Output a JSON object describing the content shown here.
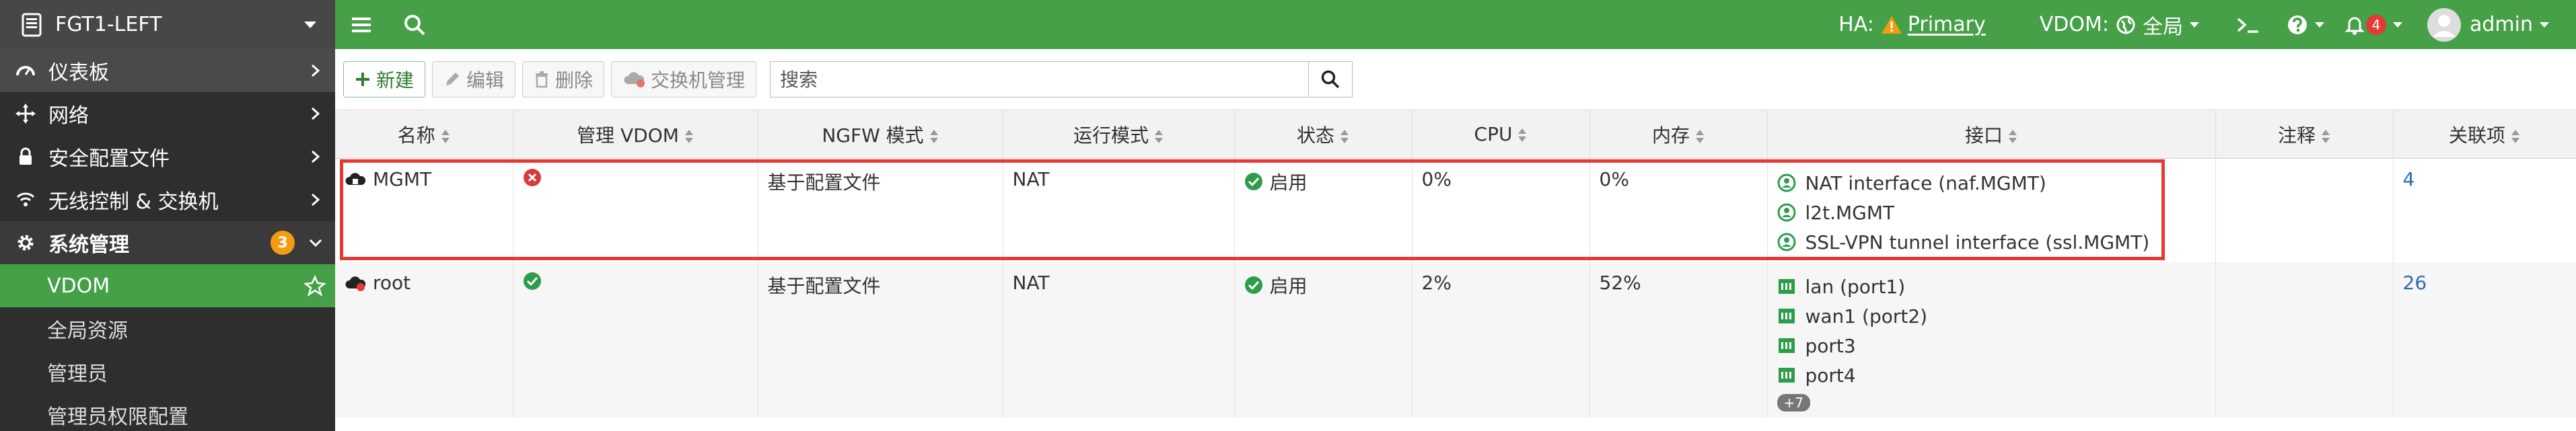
{
  "sidebar": {
    "device_name": "FGT1-LEFT",
    "items": [
      {
        "label": "仪表板",
        "icon": "dashboard-icon"
      },
      {
        "label": "网络",
        "icon": "network-icon"
      },
      {
        "label": "安全配置文件",
        "icon": "lock-icon"
      },
      {
        "label": "无线控制 & 交换机",
        "icon": "wifi-icon"
      }
    ],
    "section": {
      "label": "系统管理",
      "icon": "gear-icon",
      "badge": "3"
    },
    "sub_items": [
      {
        "label": "VDOM",
        "active": true
      },
      {
        "label": "全局资源"
      },
      {
        "label": "管理员"
      },
      {
        "label": "管理员权限配置"
      }
    ]
  },
  "topbar": {
    "ha_label": "HA:",
    "ha_value": "Primary",
    "vdom_label": "VDOM:",
    "vdom_value": "全局",
    "notification_count": "4",
    "user": "admin"
  },
  "toolbar": {
    "new_label": "新建",
    "edit_label": "编辑",
    "delete_label": "删除",
    "switch_label": "交换机管理",
    "search_placeholder": "搜索"
  },
  "table": {
    "columns": [
      "名称",
      "管理 VDOM",
      "NGFW 模式",
      "运行模式",
      "状态",
      "CPU",
      "内存",
      "接口",
      "注释",
      "关联项"
    ],
    "rows": [
      {
        "name": "MGMT",
        "mgmt_vdom": "no",
        "ngfw_mode": "基于配置文件",
        "op_mode": "NAT",
        "status": "启用",
        "cpu": "0%",
        "memory": "0%",
        "interfaces": [
          "NAT interface (naf.MGMT)",
          "l2t.MGMT",
          "SSL-VPN tunnel interface (ssl.MGMT)"
        ],
        "comment": "",
        "refs": "4"
      },
      {
        "name": "root",
        "mgmt_vdom": "yes",
        "ngfw_mode": "基于配置文件",
        "op_mode": "NAT",
        "status": "启用",
        "cpu": "2%",
        "memory": "52%",
        "interfaces": [
          "lan (port1)",
          "wan1 (port2)",
          "port3",
          "port4"
        ],
        "interfaces_more": "+7",
        "comment": "",
        "refs": "26"
      }
    ]
  },
  "colors": {
    "brand_green": "#45a047",
    "sidebar_bg": "#2e2e2e",
    "highlight_red": "#e53935",
    "ok_green": "#2e9d4a",
    "error_red": "#d63c3c",
    "link_blue": "#2b6cb0"
  }
}
